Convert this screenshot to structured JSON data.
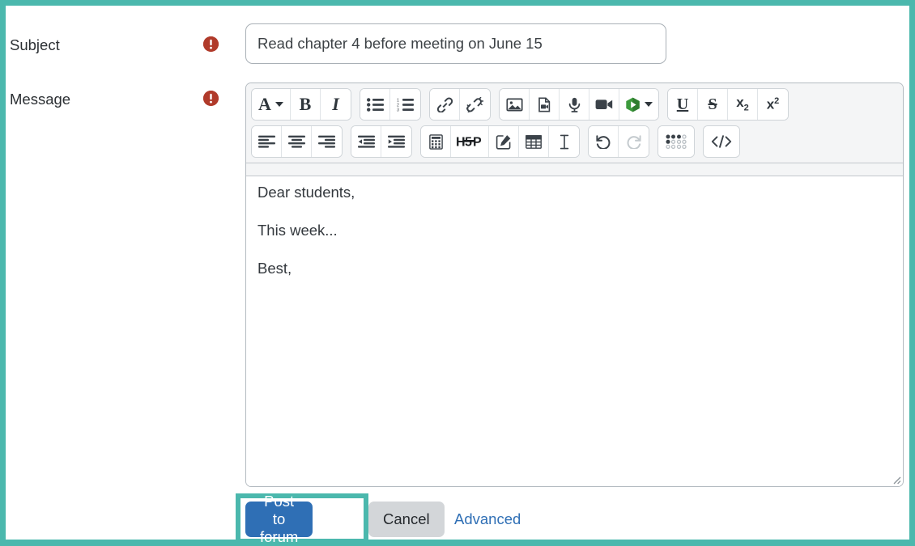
{
  "theme": {
    "highlight_color": "#4bb8ad",
    "primary_button_color": "#2f6fb5",
    "secondary_button_color": "#d3d6d9",
    "required_icon_color": "#b03a2a",
    "link_color": "#2f6fb5"
  },
  "fields": {
    "subject": {
      "label": "Subject",
      "required_icon": "required-exclamation-icon",
      "value": "Read chapter 4 before meeting on June 15",
      "placeholder": ""
    },
    "message": {
      "label": "Message",
      "required_icon": "required-exclamation-icon",
      "paragraphs": [
        "Dear students,",
        "This week...",
        "Best,"
      ]
    }
  },
  "editor": {
    "toolbar_rows": [
      {
        "groups": [
          {
            "buttons": [
              {
                "name": "font-color-icon",
                "glyph": "A",
                "has_caret": true
              },
              {
                "name": "bold-icon",
                "glyph": "B"
              },
              {
                "name": "italic-icon",
                "glyph": "I"
              }
            ]
          },
          {
            "buttons": [
              {
                "name": "bulleted-list-icon",
                "glyph": ""
              },
              {
                "name": "numbered-list-icon",
                "glyph": ""
              }
            ]
          },
          {
            "buttons": [
              {
                "name": "link-icon",
                "glyph": ""
              },
              {
                "name": "unlink-icon",
                "glyph": ""
              }
            ]
          },
          {
            "buttons": [
              {
                "name": "image-icon",
                "glyph": ""
              },
              {
                "name": "media-file-icon",
                "glyph": ""
              },
              {
                "name": "microphone-icon",
                "glyph": ""
              },
              {
                "name": "video-camera-icon",
                "glyph": ""
              },
              {
                "name": "kaltura-media-icon",
                "glyph": "",
                "has_caret": true
              }
            ]
          },
          {
            "buttons": [
              {
                "name": "underline-icon",
                "glyph": "U"
              },
              {
                "name": "strikethrough-icon",
                "glyph": "S"
              },
              {
                "name": "subscript-icon",
                "glyph": "x2"
              },
              {
                "name": "superscript-icon",
                "glyph": "x2"
              }
            ]
          }
        ]
      },
      {
        "groups": [
          {
            "buttons": [
              {
                "name": "align-left-icon",
                "glyph": ""
              },
              {
                "name": "align-center-icon",
                "glyph": ""
              },
              {
                "name": "align-right-icon",
                "glyph": ""
              }
            ]
          },
          {
            "buttons": [
              {
                "name": "outdent-icon",
                "glyph": ""
              },
              {
                "name": "indent-icon",
                "glyph": ""
              }
            ]
          },
          {
            "buttons": [
              {
                "name": "equation-calculator-icon",
                "glyph": ""
              },
              {
                "name": "h5p-icon",
                "glyph": "H-P"
              },
              {
                "name": "draw-edit-icon",
                "glyph": ""
              },
              {
                "name": "insert-table-icon",
                "glyph": ""
              },
              {
                "name": "insert-character-icon",
                "glyph": ""
              }
            ]
          },
          {
            "buttons": [
              {
                "name": "undo-icon",
                "glyph": ""
              },
              {
                "name": "redo-icon",
                "glyph": "",
                "disabled": true
              }
            ]
          },
          {
            "buttons": [
              {
                "name": "accessibility-checker-icon",
                "glyph": ""
              }
            ]
          },
          {
            "buttons": [
              {
                "name": "html-source-code-icon",
                "glyph": "</>"
              }
            ]
          }
        ]
      }
    ],
    "resize_handle": "resize-grip-icon"
  },
  "actions": {
    "post_label": "Post to forum",
    "cancel_label": "Cancel",
    "advanced_label": "Advanced"
  }
}
